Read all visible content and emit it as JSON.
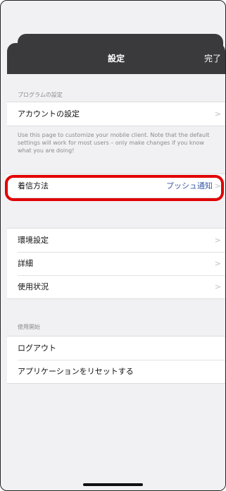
{
  "navbar": {
    "title": "設定",
    "done_label": "完了"
  },
  "program_settings": {
    "header": "プログラムの設定",
    "account_label": "アカウントの設定",
    "note": "Use this page to customize your mobile client. Note that the default settings will work for most users – only make changes if you know what you are doing!"
  },
  "call": {
    "label": "着信方法",
    "value": "プッシュ通知"
  },
  "options": {
    "items": [
      {
        "label": "環境設定"
      },
      {
        "label": "詳細"
      },
      {
        "label": "使用状況"
      }
    ]
  },
  "start": {
    "header": "使用開始",
    "items": [
      {
        "label": "ログアウト"
      },
      {
        "label": "アプリケーションをリセットする"
      }
    ]
  },
  "chevron_glyph": ">",
  "colors": {
    "highlight": "#e10000",
    "value": "#3a5ba8",
    "navbar": "#3a3a3c"
  }
}
